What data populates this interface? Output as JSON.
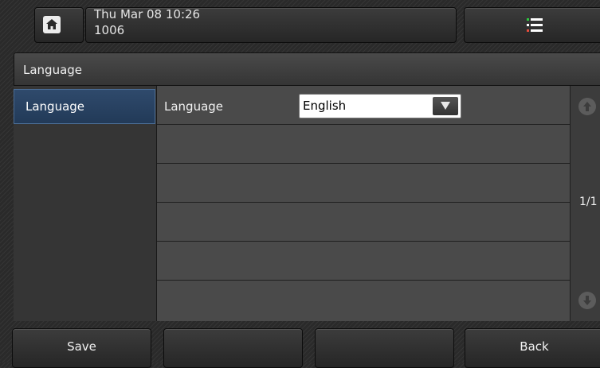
{
  "status_bar": {
    "date_time": "Thu Mar 08 10:26",
    "extension": "1006",
    "home_icon": "home-icon",
    "menu_icon": "menu-icon",
    "menu_icon_colors": [
      "#2ecc40",
      "#e74c3c",
      "#ffffff"
    ]
  },
  "title": "Language",
  "sidebar": {
    "items": [
      {
        "label": "Language",
        "selected": true
      }
    ]
  },
  "settings": {
    "rows": [
      {
        "label": "Language",
        "value": "English"
      }
    ]
  },
  "pagination": {
    "text": "1/1"
  },
  "softkeys": [
    {
      "label": "Save"
    },
    {
      "label": ""
    },
    {
      "label": ""
    },
    {
      "label": "Back"
    }
  ],
  "colors": {
    "selected_item": "#2f4a6c",
    "panel": "#4a4a4a"
  }
}
